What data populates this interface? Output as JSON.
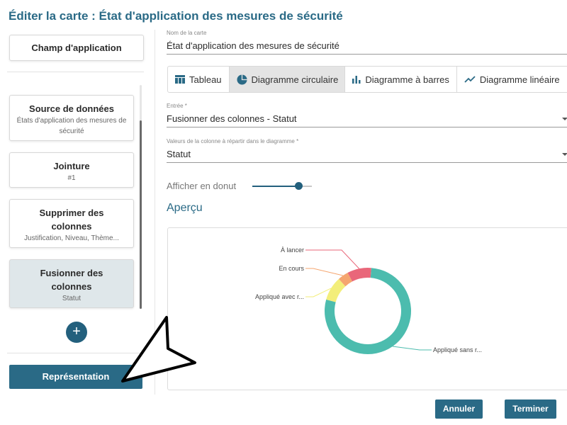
{
  "header": {
    "title": "Éditer la carte : État d'application des mesures de sécurité"
  },
  "sidebar": {
    "top_card": "Champ d'application",
    "cards": [
      {
        "title": "Source de données",
        "subtitle": "États d'application des mesures de sécurité"
      },
      {
        "title": "Jointure",
        "subtitle": "#1"
      },
      {
        "title": "Supprimer des colonnes",
        "subtitle": "Justification, Niveau, Thème..."
      },
      {
        "title": "Fusionner des colonnes",
        "subtitle": "Statut"
      }
    ],
    "add_symbol": "+",
    "representation_label": "Représentation"
  },
  "form": {
    "name_label": "Nom de la carte",
    "name_value": "État d'application des mesures de sécurité",
    "tabs": [
      {
        "label": "Tableau",
        "icon": "table-icon"
      },
      {
        "label": "Diagramme circulaire",
        "icon": "pie-chart-icon",
        "active": true
      },
      {
        "label": "Diagramme à barres",
        "icon": "bar-chart-icon"
      },
      {
        "label": "Diagramme linéaire",
        "icon": "line-chart-icon"
      }
    ],
    "entry_label": "Entrée *",
    "entry_value": "Fusionner des colonnes - Statut",
    "column_label": "Valeurs de la colonne à répartir dans le diagramme *",
    "column_value": "Statut",
    "donut_label": "Afficher en donut",
    "donut_enabled": true,
    "donut_slider_level": 0.79,
    "preview_title": "Aperçu"
  },
  "chart_data": {
    "type": "pie",
    "donut": true,
    "slices": [
      {
        "label": "Appliqué sans r...",
        "value": 78,
        "color": "#4cbcae"
      },
      {
        "label": "Appliqué avec r...",
        "value": 9,
        "color": "#f3ee7a"
      },
      {
        "label": "En cours",
        "value": 4,
        "color": "#f5a56f"
      },
      {
        "label": "À lancer",
        "value": 9,
        "color": "#e9677a"
      }
    ]
  },
  "footer": {
    "cancel_label": "Annuler",
    "finish_label": "Terminer"
  }
}
